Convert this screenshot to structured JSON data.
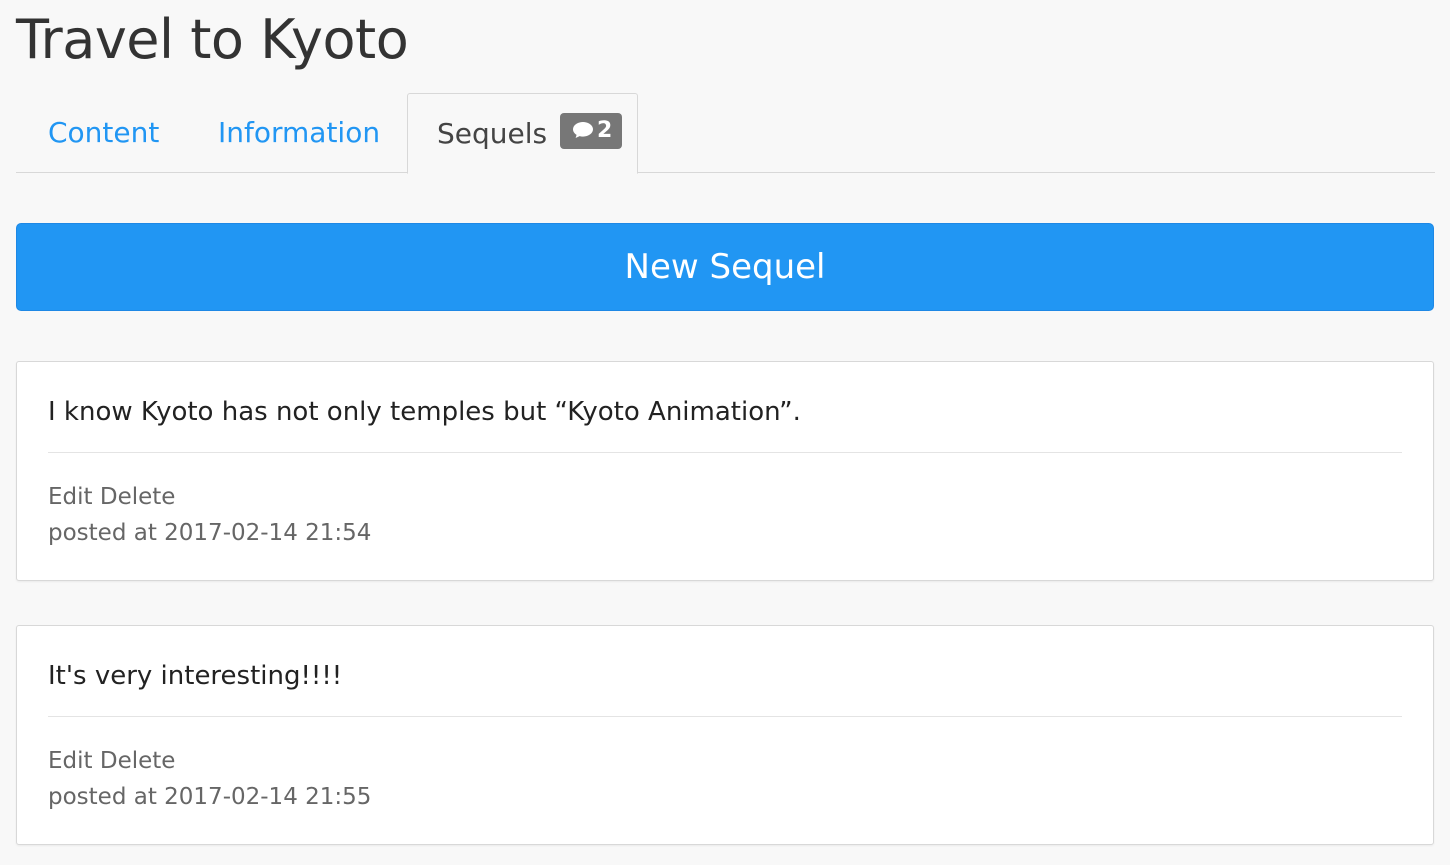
{
  "page": {
    "title": "Travel to Kyoto"
  },
  "tabs": [
    {
      "label": "Content"
    },
    {
      "label": "Information"
    },
    {
      "label": "Sequels",
      "badge_count": "2",
      "badge_icon": "comment-icon",
      "active": true
    }
  ],
  "actions": {
    "new_sequel_label": "New Sequel"
  },
  "sequels": [
    {
      "body": "I know Kyoto has not only temples but “Kyoto Animation”.",
      "edit_label": "Edit",
      "delete_label": "Delete",
      "posted": "posted at 2017-02-14 21:54"
    },
    {
      "body": "It's very interesting!!!!",
      "edit_label": "Edit",
      "delete_label": "Delete",
      "posted": "posted at 2017-02-14 21:55"
    }
  ],
  "colors": {
    "accent": "#2196f3",
    "badge": "#777777",
    "background": "#f8f8f8"
  }
}
